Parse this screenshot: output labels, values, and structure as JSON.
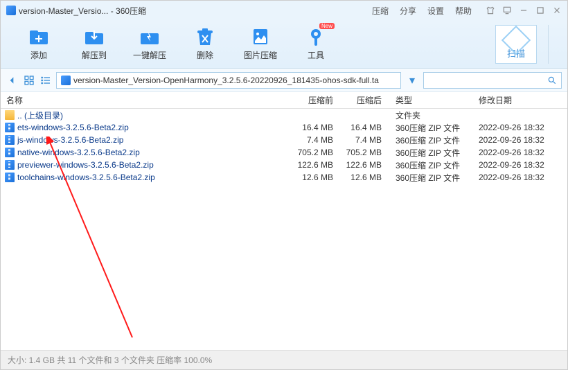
{
  "window": {
    "title": "version-Master_Versio... - 360压缩"
  },
  "menu": {
    "compress": "压缩",
    "share": "分享",
    "settings": "设置",
    "help": "帮助"
  },
  "toolbar": {
    "add": "添加",
    "extract_to": "解压到",
    "one_click_extract": "一键解压",
    "delete": "删除",
    "image_compress": "图片压缩",
    "tools": "工具",
    "scan": "扫描",
    "new_badge": "New"
  },
  "path": {
    "value": "version-Master_Version-OpenHarmony_3.2.5.6-20220926_181435-ohos-sdk-full.ta"
  },
  "columns": {
    "name": "名称",
    "before": "压缩前",
    "after": "压缩后",
    "type": "类型",
    "modified": "修改日期"
  },
  "parent_dir": {
    "name": ".. (上级目录)",
    "type": "文件夹"
  },
  "files": [
    {
      "name": "ets-windows-3.2.5.6-Beta2.zip",
      "before": "16.4 MB",
      "after": "16.4 MB",
      "type": "360压缩 ZIP 文件",
      "date": "2022-09-26 18:32"
    },
    {
      "name": "js-windows-3.2.5.6-Beta2.zip",
      "before": "7.4 MB",
      "after": "7.4 MB",
      "type": "360压缩 ZIP 文件",
      "date": "2022-09-26 18:32"
    },
    {
      "name": "native-windows-3.2.5.6-Beta2.zip",
      "before": "705.2 MB",
      "after": "705.2 MB",
      "type": "360压缩 ZIP 文件",
      "date": "2022-09-26 18:32"
    },
    {
      "name": "previewer-windows-3.2.5.6-Beta2.zip",
      "before": "122.6 MB",
      "after": "122.6 MB",
      "type": "360压缩 ZIP 文件",
      "date": "2022-09-26 18:32"
    },
    {
      "name": "toolchains-windows-3.2.5.6-Beta2.zip",
      "before": "12.6 MB",
      "after": "12.6 MB",
      "type": "360压缩 ZIP 文件",
      "date": "2022-09-26 18:32"
    }
  ],
  "status": {
    "text": "大小: 1.4 GB 共 11 个文件和 3 个文件夹 压缩率 100.0%"
  }
}
